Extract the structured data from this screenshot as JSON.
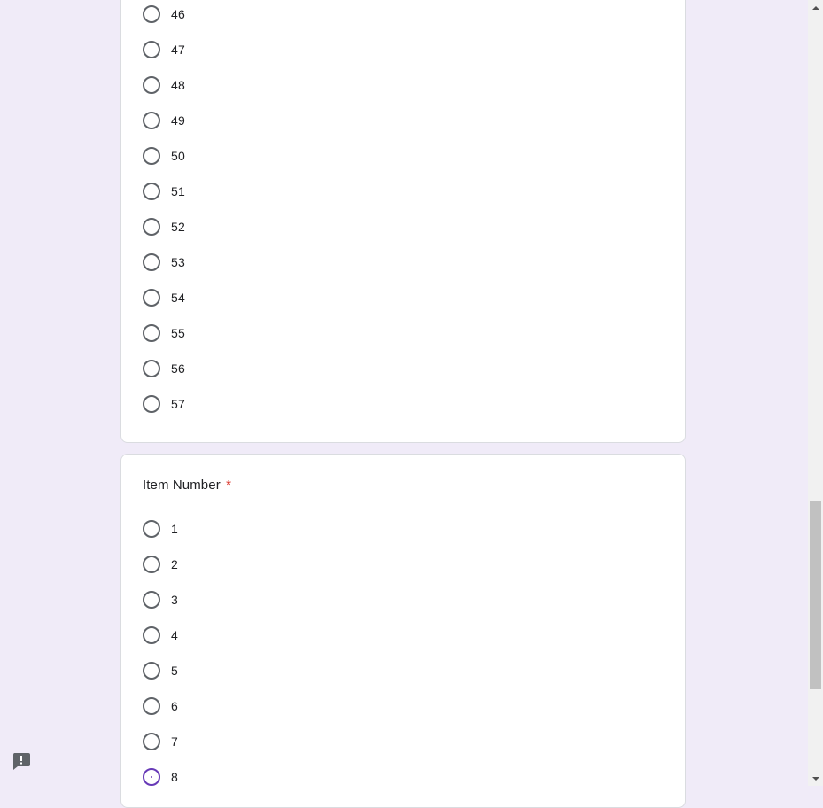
{
  "question_top": {
    "options": [
      "46",
      "47",
      "48",
      "49",
      "50",
      "51",
      "52",
      "53",
      "54",
      "55",
      "56",
      "57"
    ]
  },
  "question_item_number": {
    "title": "Item Number",
    "required_marker": "*",
    "options": [
      "1",
      "2",
      "3",
      "4",
      "5",
      "6",
      "7",
      "8"
    ],
    "selected": "8"
  },
  "icons": {
    "feedback": "report-feedback-icon",
    "scroll_up": "scroll-up-arrow-icon",
    "scroll_down": "scroll-down-arrow-icon"
  },
  "colors": {
    "page_background": "#f0ebf8",
    "accent": "#673ab7",
    "required": "#d93025"
  }
}
